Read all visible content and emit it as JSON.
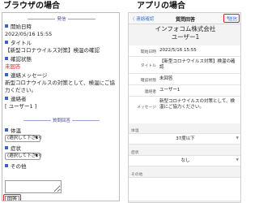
{
  "browser": {
    "title": "ブラウザの場合",
    "section_announce": "発信",
    "fields": {
      "start_label": "開始日時",
      "start_value": "2022/05/16 15:55",
      "title_label": "タイトル",
      "title_value": "【新型コロナウイルス対策】検温の確認",
      "status_label": "確認状態",
      "status_value": "未回答",
      "message_label": "連絡メッセージ",
      "message_value": "新型コロナウイルスの対策として、検温にご協力ください。",
      "contact_label": "連絡者",
      "contact_value": "[ ユーザー1 ]"
    },
    "section_answer": "質問回答",
    "questions": {
      "temp_label": "体温",
      "temp_select": "(選択して下さい)",
      "symptom_label": "症状",
      "symptom_select": "(選択して下さい)",
      "other_label": "その他"
    },
    "answer_button": "回答"
  },
  "app": {
    "title": "アプリの場合",
    "nav": {
      "back": "〈 連絡確認",
      "title": "質問回答",
      "send": "送信"
    },
    "company": "インフォコム株式会社",
    "user": "ユーザー1",
    "rows": {
      "start_label": "開始日時",
      "start_value": "2022/5/16 15:55",
      "title_label": "タイトル",
      "title_value": "【新型コロナウイルス対策】検温の確認",
      "status_label": "確認状態",
      "status_value": "未回答",
      "sender_label": "連絡者",
      "sender_value": "ユーザー1",
      "message_label": "メッセージ",
      "message_value": "新型コロナウイルスの対策として、検温にご協力ください。"
    },
    "answers": {
      "temp_label": "体温",
      "temp_value": "37度以下",
      "symptom_label": "症状",
      "symptom_value": "なし",
      "other_label": "その他"
    }
  },
  "colors": {
    "accent": "#3c64c8",
    "highlight": "#e02020",
    "link": "#3c78d8"
  }
}
